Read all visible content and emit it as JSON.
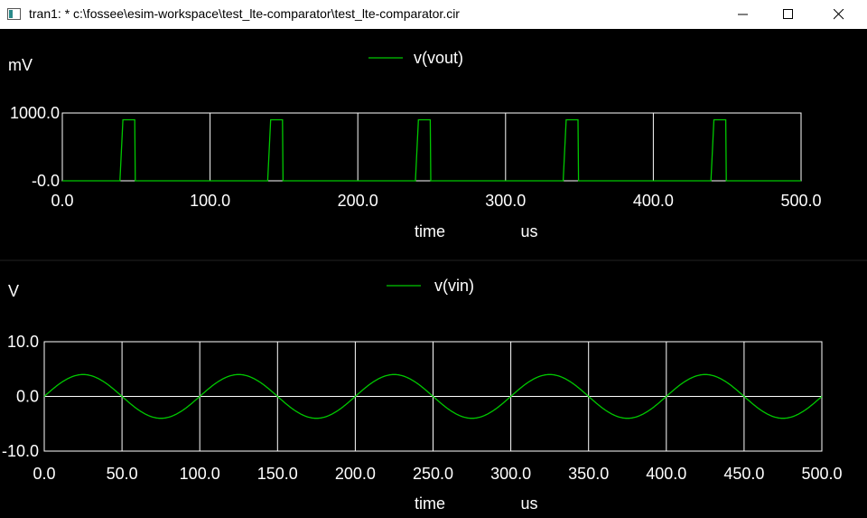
{
  "window": {
    "title": "tran1: * c:\\fossee\\esim-workspace\\test_lte-comparator\\test_lte-comparator.cir"
  },
  "colors": {
    "trace": "#00c800",
    "grid": "#ffffff",
    "background": "#000000"
  },
  "chart_data": [
    {
      "type": "line",
      "yunit": "mV",
      "legend": "v(vout)",
      "xlabel": "time",
      "xunit": "us",
      "x_ticks": [
        "0.0",
        "100.0",
        "200.0",
        "300.0",
        "400.0",
        "500.0"
      ],
      "y_ticks": [
        "-0.0",
        "1000.0"
      ],
      "xlim": [
        0,
        500
      ],
      "ylim": [
        0,
        1000
      ],
      "series": [
        {
          "name": "v(vout)",
          "pulses": [
            [
              41,
              49
            ],
            [
              141,
              149
            ],
            [
              241,
              249
            ],
            [
              341,
              349
            ],
            [
              441,
              449
            ]
          ],
          "high": 900,
          "low": 0
        }
      ]
    },
    {
      "type": "line",
      "yunit": "V",
      "legend": "v(vin)",
      "xlabel": "time",
      "xunit": "us",
      "x_ticks": [
        "0.0",
        "50.0",
        "100.0",
        "150.0",
        "200.0",
        "250.0",
        "300.0",
        "350.0",
        "400.0",
        "450.0",
        "500.0"
      ],
      "y_ticks": [
        "-10.0",
        "0.0",
        "10.0"
      ],
      "xlim": [
        0,
        500
      ],
      "ylim": [
        -10,
        10
      ],
      "series": [
        {
          "name": "v(vin)",
          "amplitude": 4,
          "period": 100,
          "phase": 0
        }
      ]
    }
  ]
}
